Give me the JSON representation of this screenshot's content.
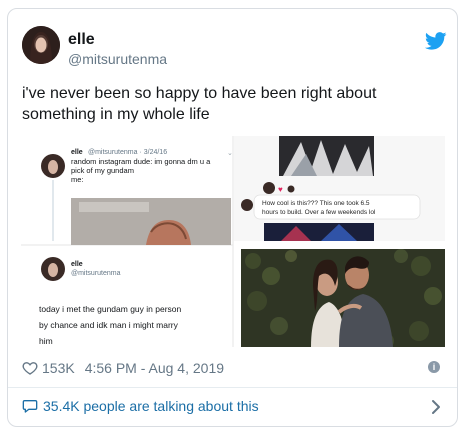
{
  "user": {
    "name": "elle",
    "handle": "@mitsurutenma"
  },
  "tweet": {
    "text": "i've never been so happy to have been right about something in my whole life"
  },
  "media": {
    "top_left": {
      "name": "elle",
      "meta": "@mitsurutenma · 3/24/16",
      "lines": [
        "random instagram dude: im gonna dm u a",
        "pick of my gundam",
        "me:"
      ]
    },
    "bottom_left": {
      "name": "elle",
      "handle": "@mitsurutenma",
      "lines": [
        "today i met the gundam guy in person",
        "by chance and idk man i might marry",
        "him"
      ]
    },
    "top_right": {
      "caption_lines": [
        "How cool is this??? This one took 6.5",
        "hours to build. Over a few weekends lol"
      ]
    }
  },
  "footer": {
    "likes": "153K",
    "timestamp": "4:56 PM - Aug 4, 2019",
    "info_glyph": "i"
  },
  "conversation": {
    "label": "35.4K people are talking about this"
  },
  "colors": {
    "twitter_blue": "#1da1f2",
    "link_blue": "#1b6ea6",
    "muted": "#657786",
    "text": "#14171a"
  },
  "icons": [
    "twitter-bird-icon",
    "heart-icon",
    "info-icon",
    "chat-bubble-icon",
    "chevron-right-icon"
  ]
}
